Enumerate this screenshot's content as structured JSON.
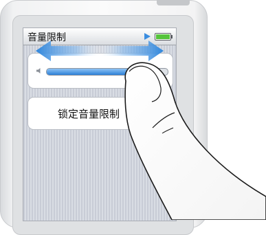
{
  "screen": {
    "title": "音量限制",
    "status_icons": [
      "play-icon",
      "battery-icon"
    ]
  },
  "volume": {
    "icon": "speaker-icon",
    "level": 0.82
  },
  "lock_button": {
    "label": "锁定音量限制"
  },
  "gesture": {
    "icon": "swipe-arrow",
    "direction": "left-right"
  },
  "colors": {
    "accent": "#2f86dc",
    "battery": "#56c43c"
  }
}
